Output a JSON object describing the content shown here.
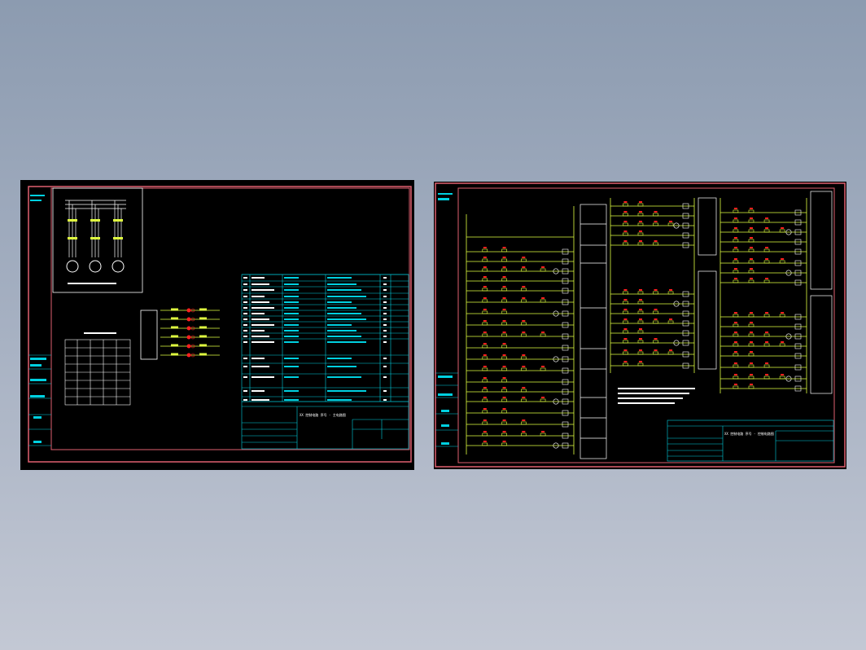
{
  "colors": {
    "background_top": "#8c9bb0",
    "background_bottom": "#c3c8d4",
    "sheet": "#000000",
    "border": "#e06070",
    "frame_line": "#00d0e0",
    "wire": "#e0ff40",
    "component": "#ff2020",
    "white": "#ffffff"
  },
  "left_sheet": {
    "title_block_label": "XX 控制电路 序号 - 主电路图",
    "switch_labels": [
      "SA1",
      "SA2",
      "SA3",
      "SA4",
      "SA5",
      "SA6"
    ]
  },
  "right_sheet": {
    "title_block_label": "XX 控制电路 序号 - 控制电路图"
  },
  "icons": [
    "motor-icon",
    "contact-icon",
    "coil-icon",
    "lamp-icon"
  ]
}
